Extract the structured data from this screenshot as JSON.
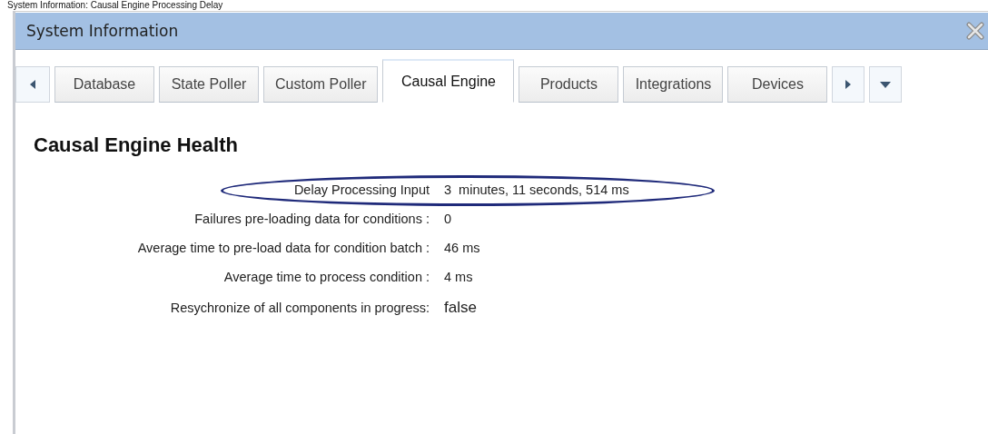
{
  "caption": "System Information: Causal Engine Processing Delay",
  "window": {
    "title": "System Information"
  },
  "tabs": [
    {
      "label": "Database",
      "selected": false
    },
    {
      "label": "State Poller",
      "selected": false
    },
    {
      "label": "Custom Poller",
      "selected": false
    },
    {
      "label": "Causal Engine",
      "selected": true
    },
    {
      "label": "Products",
      "selected": false
    },
    {
      "label": "Integrations",
      "selected": false
    },
    {
      "label": "Devices",
      "selected": false
    }
  ],
  "heading": "Causal Engine Health",
  "fields": [
    {
      "label": "Delay Processing Input",
      "value": "3  minutes, 11 seconds, 514 ms",
      "highlighted": true
    },
    {
      "label": "Failures pre-loading data for conditions :",
      "value": "0",
      "highlighted": false
    },
    {
      "label": "Average time to pre-load data for condition batch :",
      "value": "46 ms",
      "highlighted": false
    },
    {
      "label": "Average time to process condition :",
      "value": "4 ms",
      "highlighted": false
    },
    {
      "label": "Resychronize of all components in progress:",
      "value": "false",
      "highlighted": false
    }
  ]
}
